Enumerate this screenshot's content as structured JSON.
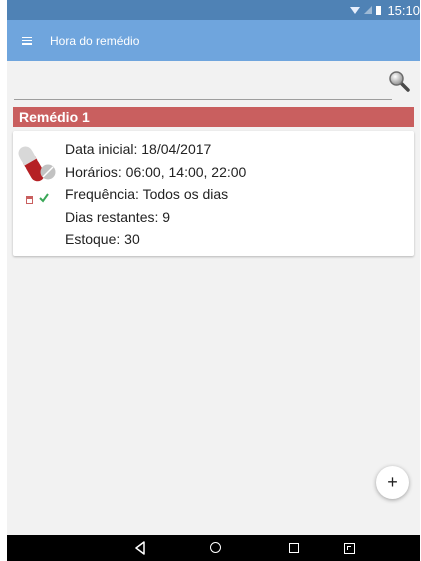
{
  "status_bar": {
    "time": "15:10"
  },
  "app_bar": {
    "title": "Hora do remédio",
    "menu_icon": "hamburger-menu-icon"
  },
  "search": {
    "placeholder": "",
    "icon": "search-icon"
  },
  "medicines": [
    {
      "name": "Remédio 1",
      "header_color": "#c95f5f",
      "icons": [
        "pill-icon",
        "calendar-icon",
        "check-icon"
      ],
      "lines": [
        "Data inicial: 18/04/2017",
        "Horários: 06:00, 14:00, 22:00",
        "Frequência: Todos os dias",
        "Dias restantes: 9",
        "Estoque: 30"
      ]
    }
  ],
  "fab": {
    "label": "+",
    "icon": "add-icon"
  },
  "nav_bar": {
    "icons": [
      "back-icon",
      "home-icon",
      "recents-icon",
      "resize-icon"
    ]
  },
  "colors": {
    "status_bar": "#4f82b5",
    "app_bar": "#6fa5dd",
    "accent": "#c95f5f",
    "background": "#f2f2f2",
    "check": "#3aa757"
  }
}
